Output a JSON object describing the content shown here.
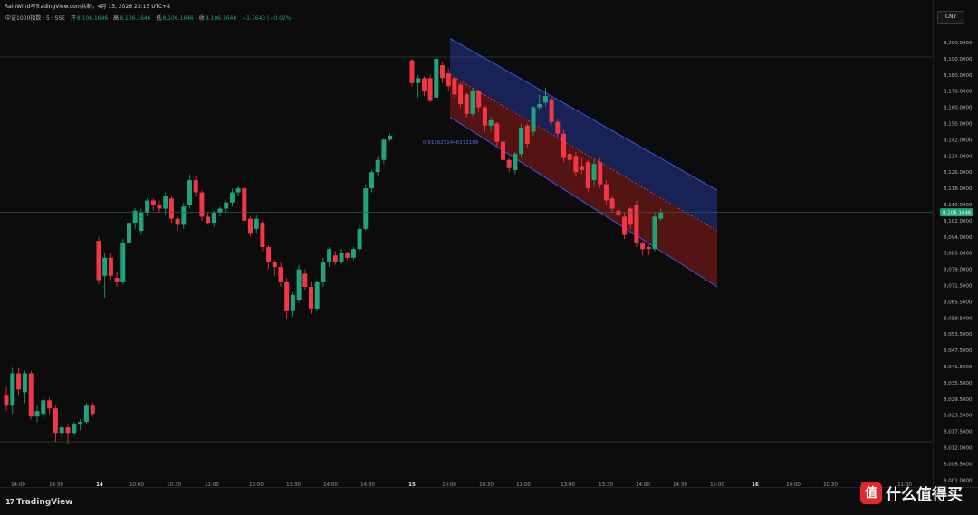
{
  "header": {
    "title": "RainWind与TradingView.com共制，4月 15, 2026 23:15 UTC+8",
    "symbol": "中证1000指数 · 5 · SSE",
    "ohlc": [
      {
        "label": "开",
        "value": "8,106.1646"
      },
      {
        "label": "高",
        "value": "8,106.1646"
      },
      {
        "label": "低",
        "value": "8,106.1646"
      },
      {
        "label": "收",
        "value": "8,106.1646"
      }
    ],
    "change": "−1.7643 (−0.02%)"
  },
  "currency_button": "CNY",
  "brand": "TradingView",
  "brand_mark": "17",
  "watermark": {
    "logo": "值",
    "text": "什么值得买"
  },
  "colors": {
    "up": "#1fa37a",
    "down": "#f23645",
    "channel_upper": "#2b3fb0",
    "channel_lower": "#9b1b1b"
  },
  "chart_data": {
    "type": "candlestick",
    "y_ticks": [
      "8,200.0000",
      "8,190.0000",
      "8,180.0000",
      "8,170.0000",
      "8,160.0000",
      "8,150.0000",
      "8,142.0000",
      "8,134.0000",
      "8,126.0000",
      "8,118.0000",
      "8,110.0000",
      "8,102.0000",
      "8,094.0000",
      "8,086.0000",
      "8,079.0000",
      "8,071.5000",
      "8,065.5000",
      "8,059.5000",
      "8,053.5000",
      "8,047.5000",
      "8,041.5000",
      "8,035.5000",
      "8,029.5000",
      "8,023.5000",
      "8,017.5000",
      "8,012.0000",
      "8,006.5000",
      "8,001.0000"
    ],
    "x_ticks": [
      "14:00",
      "14:30",
      "14",
      "10:00",
      "10:30",
      "11:00",
      "13:00",
      "13:30",
      "14:00",
      "14:30",
      "15",
      "10:00",
      "10:30",
      "11:00",
      "13:00",
      "13:30",
      "14:00",
      "14:30",
      "15:00",
      "16",
      "10:00",
      "10:30",
      "11:00",
      "11:30"
    ],
    "x_ticks_bold": [
      false,
      false,
      true,
      false,
      false,
      false,
      false,
      false,
      false,
      false,
      true,
      false,
      false,
      false,
      false,
      false,
      false,
      false,
      false,
      true,
      false,
      false,
      false,
      false
    ],
    "last_price": "8,106.1646",
    "channel_label": "0.9116271446172169",
    "candles": [
      [
        8031.0,
        8027.0,
        8034.0,
        8025.0
      ],
      [
        8027.0,
        8039.0,
        8041.0,
        8024.0
      ],
      [
        8039.0,
        8033.0,
        8041.0,
        8031.0
      ],
      [
        8032.0,
        8039.0,
        8040.0,
        8028.0
      ],
      [
        8039.0,
        8023.0,
        8040.0,
        8022.0
      ],
      [
        8023.0,
        8025.0,
        8027.0,
        8021.0
      ],
      [
        8024.0,
        8029.0,
        8030.0,
        8022.0
      ],
      [
        8029.0,
        8026.0,
        8030.0,
        8024.0
      ],
      [
        8026.0,
        8017.0,
        8027.0,
        8014.0
      ],
      [
        8017.0,
        8019.0,
        8021.0,
        8014.0
      ],
      [
        8019.0,
        8017.0,
        8020.0,
        8013.0
      ],
      [
        8017.0,
        8020.0,
        8021.0,
        8016.0
      ],
      [
        8020.0,
        8021.0,
        8022.0,
        8018.0
      ],
      [
        8021.0,
        8027.0,
        8028.0,
        8020.0
      ],
      [
        8027.0,
        8024.0,
        8028.0,
        8023.0
      ],
      [
        8092.0,
        8074.0,
        8094.0,
        8072.0
      ],
      [
        8076.0,
        8084.0,
        8086.0,
        8067.0
      ],
      [
        8084.0,
        8076.0,
        8086.0,
        8074.0
      ],
      [
        8075.0,
        8073.0,
        8078.0,
        8071.0
      ],
      [
        8073.0,
        8091.0,
        8093.0,
        8072.0
      ],
      [
        8091.0,
        8101.0,
        8104.0,
        8088.0
      ],
      [
        8101.0,
        8107.0,
        8108.0,
        8098.0
      ],
      [
        8097.0,
        8106.0,
        8108.0,
        8095.0
      ],
      [
        8106.0,
        8112.0,
        8113.0,
        8104.0
      ],
      [
        8112.0,
        8110.0,
        8113.0,
        8107.0
      ],
      [
        8110.0,
        8108.0,
        8112.0,
        8106.0
      ],
      [
        8108.0,
        8114.0,
        8116.0,
        8105.0
      ],
      [
        8113.0,
        8103.0,
        8114.0,
        8101.0
      ],
      [
        8103.0,
        8100.0,
        8104.0,
        8097.0
      ],
      [
        8100.0,
        8109.0,
        8111.0,
        8098.0
      ],
      [
        8110.0,
        8122.0,
        8125.0,
        8108.0
      ],
      [
        8122.0,
        8116.0,
        8124.0,
        8114.0
      ],
      [
        8116.0,
        8104.0,
        8117.0,
        8102.0
      ],
      [
        8104.0,
        8101.0,
        8106.0,
        8100.0
      ],
      [
        8101.0,
        8106.0,
        8107.0,
        8099.0
      ],
      [
        8106.0,
        8108.0,
        8109.0,
        8104.0
      ],
      [
        8108.0,
        8111.0,
        8112.0,
        8106.0
      ],
      [
        8111.0,
        8116.0,
        8118.0,
        8109.0
      ],
      [
        8116.0,
        8118.0,
        8119.0,
        8114.0
      ],
      [
        8118.0,
        8102.0,
        8119.0,
        8100.0
      ],
      [
        8103.0,
        8096.0,
        8104.0,
        8094.0
      ],
      [
        8098.0,
        8103.0,
        8105.0,
        8096.0
      ],
      [
        8101.0,
        8089.0,
        8102.0,
        8087.0
      ],
      [
        8089.0,
        8082.0,
        8090.0,
        8079.0
      ],
      [
        8082.0,
        8080.0,
        8083.0,
        8076.0
      ],
      [
        8080.0,
        8073.0,
        8082.0,
        8071.0
      ],
      [
        8073.0,
        8062.0,
        8075.0,
        8059.0
      ],
      [
        8062.0,
        8068.0,
        8069.0,
        8060.0
      ],
      [
        8066.0,
        8079.0,
        8081.0,
        8065.0
      ],
      [
        8077.0,
        8071.0,
        8079.0,
        8070.0
      ],
      [
        8071.0,
        8063.0,
        8073.0,
        8061.0
      ],
      [
        8063.0,
        8073.0,
        8074.0,
        8062.0
      ],
      [
        8073.0,
        8082.0,
        8084.0,
        8071.0
      ],
      [
        8082.0,
        8088.0,
        8089.0,
        8080.0
      ],
      [
        8085.0,
        8082.0,
        8087.0,
        8081.0
      ],
      [
        8082.0,
        8086.0,
        8088.0,
        8081.0
      ],
      [
        8086.0,
        8084.0,
        8087.0,
        8083.0
      ],
      [
        8084.0,
        8088.0,
        8089.0,
        8083.0
      ],
      [
        8088.0,
        8098.0,
        8100.0,
        8087.0
      ],
      [
        8098.0,
        8118.0,
        8120.0,
        8097.0
      ],
      [
        8118.0,
        8126.0,
        8127.0,
        8116.0
      ],
      [
        8126.0,
        8132.0,
        8134.0,
        8124.0
      ],
      [
        8132.0,
        8142.0,
        8143.0,
        8130.0
      ],
      [
        8142.0,
        8144.0,
        8145.0,
        8141.0
      ],
      [
        8189.0,
        8175.0,
        8190.0,
        8173.0
      ],
      [
        8175.0,
        8178.0,
        8180.0,
        8166.0
      ],
      [
        8178.0,
        8170.0,
        8179.0,
        8167.0
      ],
      [
        8178.0,
        8164.0,
        8180.0,
        8163.0
      ],
      [
        8166.0,
        8190.0,
        8192.0,
        8164.0
      ],
      [
        8186.0,
        8178.0,
        8188.0,
        8175.0
      ],
      [
        8181.0,
        8173.0,
        8184.0,
        8170.0
      ],
      [
        8178.0,
        8168.0,
        8179.0,
        8166.0
      ],
      [
        8174.0,
        8162.0,
        8175.0,
        8160.0
      ],
      [
        8168.0,
        8156.0,
        8169.0,
        8154.0
      ],
      [
        8156.0,
        8170.0,
        8172.0,
        8154.0
      ],
      [
        8170.0,
        8160.0,
        8171.0,
        8157.0
      ],
      [
        8160.0,
        8149.0,
        8161.0,
        8146.0
      ],
      [
        8149.0,
        8152.0,
        8154.0,
        8146.0
      ],
      [
        8150.0,
        8141.0,
        8151.0,
        8139.0
      ],
      [
        8141.0,
        8132.0,
        8143.0,
        8130.0
      ],
      [
        8132.0,
        8128.0,
        8133.0,
        8126.0
      ],
      [
        8127.0,
        8135.0,
        8136.0,
        8125.0
      ],
      [
        8135.0,
        8148.0,
        8150.0,
        8133.0
      ],
      [
        8149.0,
        8140.0,
        8150.0,
        8138.0
      ],
      [
        8146.0,
        8160.0,
        8161.0,
        8144.0
      ],
      [
        8160.0,
        8162.0,
        8168.0,
        8158.0
      ],
      [
        8163.0,
        8167.0,
        8172.0,
        8161.0
      ],
      [
        8165.0,
        8151.0,
        8166.0,
        8149.0
      ],
      [
        8151.0,
        8145.0,
        8153.0,
        8143.0
      ],
      [
        8145.0,
        8133.0,
        8147.0,
        8131.0
      ],
      [
        8135.0,
        8132.0,
        8137.0,
        8130.0
      ],
      [
        8134.0,
        8126.0,
        8136.0,
        8124.0
      ],
      [
        8129.0,
        8127.0,
        8133.0,
        8125.0
      ],
      [
        8131.0,
        8118.0,
        8132.0,
        8116.0
      ],
      [
        8122.0,
        8130.0,
        8132.0,
        8119.0
      ],
      [
        8131.0,
        8120.0,
        8133.0,
        8118.0
      ],
      [
        8120.0,
        8112.0,
        8122.0,
        8110.0
      ],
      [
        8113.0,
        8108.0,
        8114.0,
        8106.0
      ],
      [
        8107.0,
        8105.0,
        8109.0,
        8104.0
      ],
      [
        8104.0,
        8095.0,
        8106.0,
        8093.0
      ],
      [
        8108.0,
        8100.0,
        8109.0,
        8098.0
      ],
      [
        8110.0,
        8091.0,
        8112.0,
        8089.0
      ],
      [
        8091.0,
        8088.0,
        8092.0,
        8085.0
      ],
      [
        8089.0,
        8088.0,
        8090.0,
        8085.0
      ],
      [
        8088.0,
        8104.0,
        8106.0,
        8087.0
      ],
      [
        8103.0,
        8106.0,
        8108.0,
        8102.0
      ]
    ]
  }
}
